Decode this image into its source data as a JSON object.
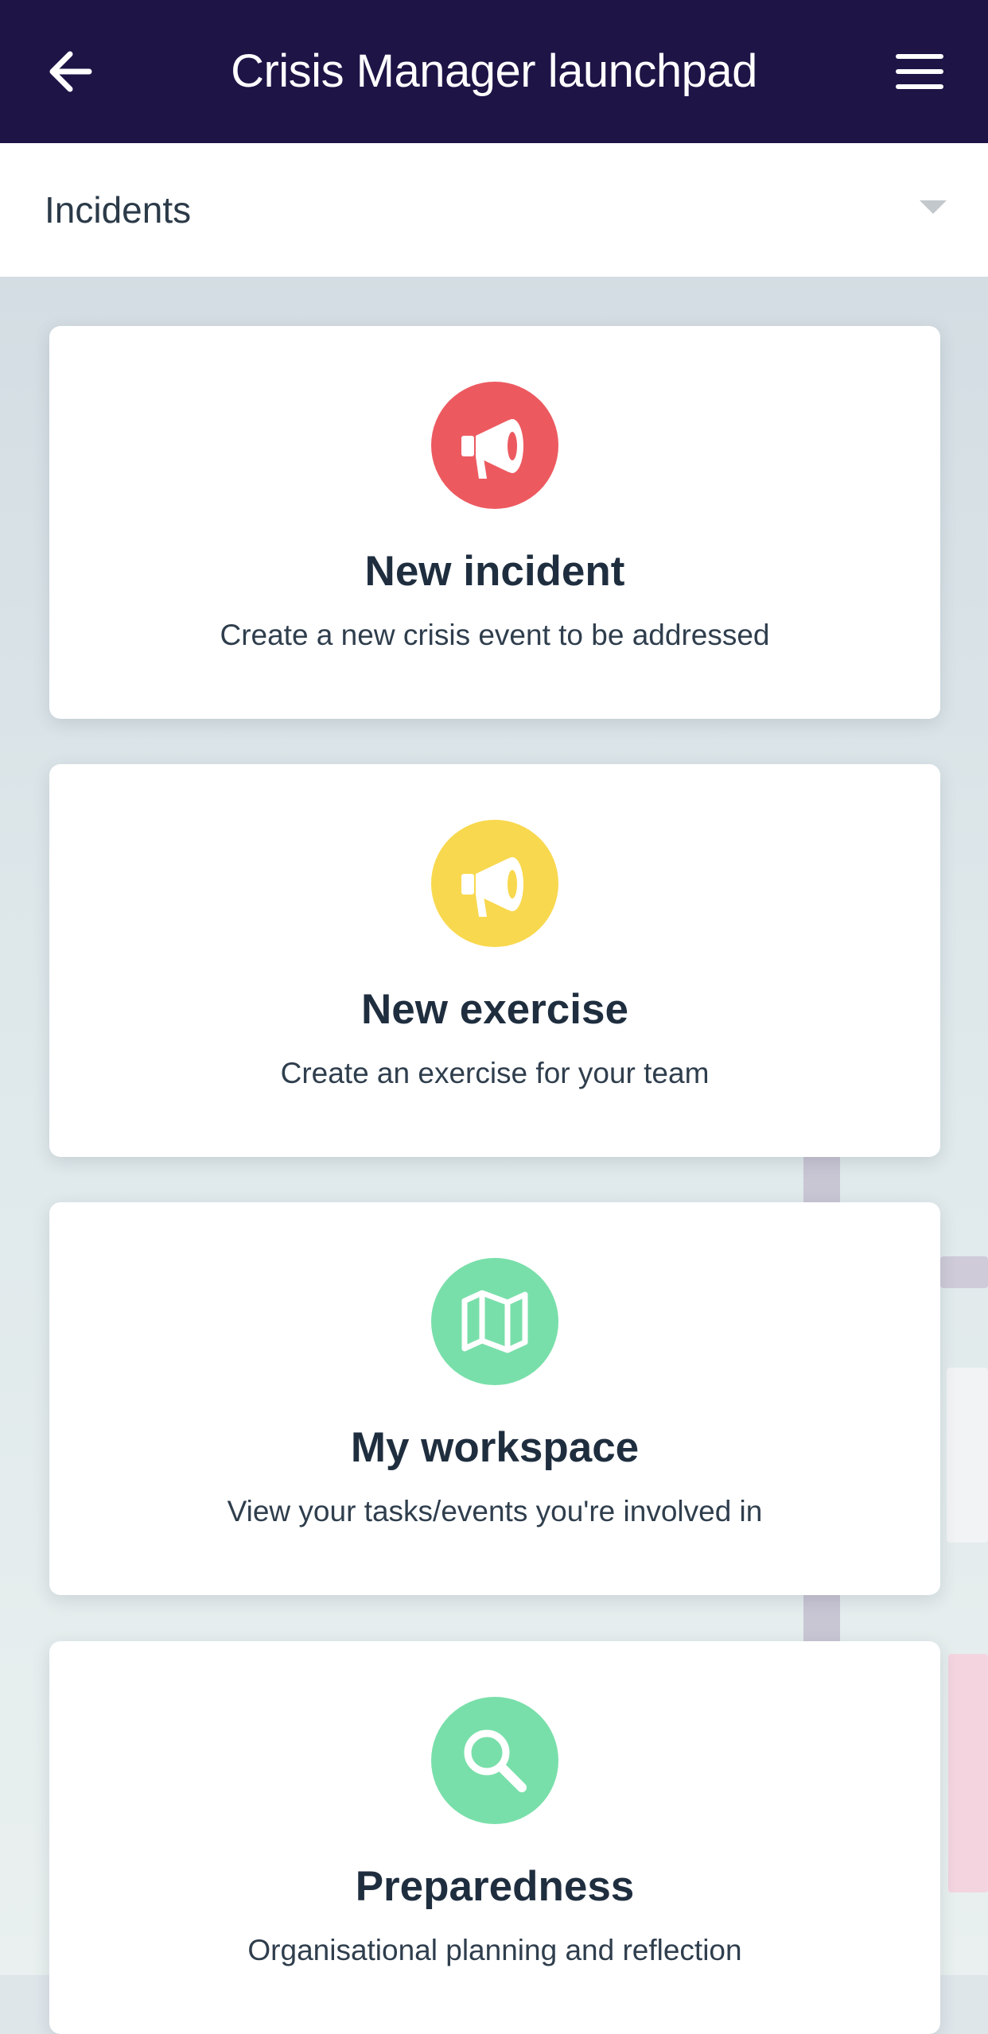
{
  "header": {
    "title": "Crisis Manager launchpad",
    "back_icon": "arrow-left-icon",
    "menu_icon": "hamburger-menu-icon",
    "background_color": "#1e1446"
  },
  "selector": {
    "value": "Incidents",
    "caret_icon": "caret-down-icon"
  },
  "cards": [
    {
      "title": "New incident",
      "description": "Create a new crisis event to be addressed",
      "icon": "megaphone-icon",
      "color": "#ec5a60"
    },
    {
      "title": "New exercise",
      "description": "Create an exercise for your team",
      "icon": "megaphone-icon",
      "color": "#f8d84e"
    },
    {
      "title": "My workspace",
      "description": "View your tasks/events you're involved in",
      "icon": "map-icon",
      "color": "#79dfaa"
    },
    {
      "title": "Preparedness",
      "description": "Organisational planning and reflection",
      "icon": "search-icon",
      "color": "#79dfaa"
    }
  ]
}
